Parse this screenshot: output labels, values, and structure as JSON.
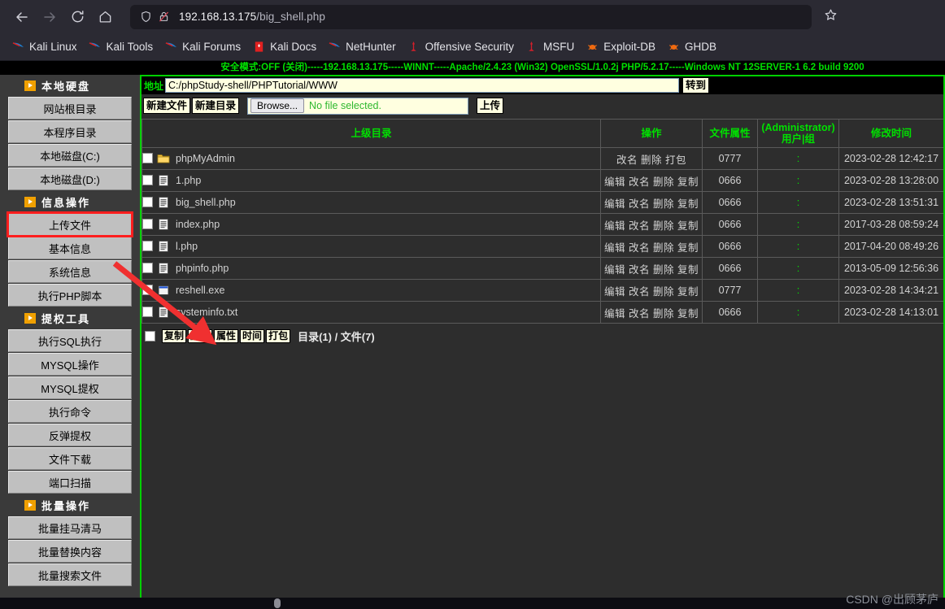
{
  "browser": {
    "back_icon": "back-arrow-icon",
    "forward_icon": "forward-arrow-icon",
    "reload_icon": "reload-icon",
    "home_icon": "home-icon",
    "url_host": "192.168.13.175",
    "url_path": "/big_shell.php",
    "shield_icon": "shield-icon",
    "lock_broken_icon": "lock-crossed-icon",
    "star_icon": "bookmark-star-icon",
    "bookmarks": [
      {
        "label": "Kali Linux",
        "icon": "kali-dragon-icon"
      },
      {
        "label": "Kali Tools",
        "icon": "kali-dragon-icon"
      },
      {
        "label": "Kali Forums",
        "icon": "kali-dragon-icon"
      },
      {
        "label": "Kali Docs",
        "icon": "kali-docs-icon"
      },
      {
        "label": "NetHunter",
        "icon": "kali-dragon-icon"
      },
      {
        "label": "Offensive Security",
        "icon": "offsec-icon"
      },
      {
        "label": "MSFU",
        "icon": "offsec-icon"
      },
      {
        "label": "Exploit-DB",
        "icon": "exploitdb-icon"
      },
      {
        "label": "GHDB",
        "icon": "exploitdb-icon"
      }
    ]
  },
  "status_banner": "安全模式:OFF (关闭)-----192.168.13.175-----WINNT-----Apache/2.4.23 (Win32) OpenSSL/1.0.2j PHP/5.2.17-----Windows NT 12SERVER-1 6.2 build 9200",
  "sidebar": {
    "sections": [
      {
        "title": "本地硬盘",
        "items": [
          {
            "label": "网站根目录",
            "highlight": false
          },
          {
            "label": "本程序目录",
            "highlight": false
          },
          {
            "label": "本地磁盘(C:)",
            "highlight": false
          },
          {
            "label": "本地磁盘(D:)",
            "highlight": false
          }
        ]
      },
      {
        "title": "信息操作",
        "items": [
          {
            "label": "上传文件",
            "highlight": true
          },
          {
            "label": "基本信息",
            "highlight": false
          },
          {
            "label": "系统信息",
            "highlight": false
          },
          {
            "label": "执行PHP脚本",
            "highlight": false
          }
        ]
      },
      {
        "title": "提权工具",
        "items": [
          {
            "label": "执行SQL执行",
            "highlight": false
          },
          {
            "label": "MYSQL操作",
            "highlight": false
          },
          {
            "label": "MYSQL提权",
            "highlight": false
          },
          {
            "label": "执行命令",
            "highlight": false
          },
          {
            "label": "反弹提权",
            "highlight": false
          },
          {
            "label": "文件下载",
            "highlight": false
          },
          {
            "label": "端口扫描",
            "highlight": false
          }
        ]
      },
      {
        "title": "批量操作",
        "items": [
          {
            "label": "批量挂马清马",
            "highlight": false
          },
          {
            "label": "批量替换内容",
            "highlight": false
          },
          {
            "label": "批量搜索文件",
            "highlight": false
          }
        ]
      }
    ]
  },
  "filemanager": {
    "address_label": "地址",
    "address_value": "C:/phpStudy-shell/PHPTutorial/WWW",
    "go_label": "转到",
    "new_file_label": "新建文件",
    "new_dir_label": "新建目录",
    "browse_label": "Browse...",
    "file_status": "No file selected.",
    "upload_label": "上传",
    "columns": {
      "name": "上级目录",
      "ops": "操作",
      "attr": "文件属性",
      "owner": "(Administrator)用户|组",
      "time": "修改时间"
    },
    "rows": [
      {
        "name": "phpMyAdmin",
        "icon": "folder-icon",
        "ops": "改名 删除 打包",
        "attr": "0777",
        "owner": ":",
        "time": "2023-02-28 12:42:17"
      },
      {
        "name": "1.php",
        "icon": "text-file-icon",
        "ops": "编辑 改名 删除 复制",
        "attr": "0666",
        "owner": ":",
        "time": "2023-02-28 13:28:00"
      },
      {
        "name": "big_shell.php",
        "icon": "text-file-icon",
        "ops": "编辑 改名 删除 复制",
        "attr": "0666",
        "owner": ":",
        "time": "2023-02-28 13:51:31"
      },
      {
        "name": "index.php",
        "icon": "text-file-icon",
        "ops": "编辑 改名 删除 复制",
        "attr": "0666",
        "owner": ":",
        "time": "2017-03-28 08:59:24"
      },
      {
        "name": "l.php",
        "icon": "text-file-icon",
        "ops": "编辑 改名 删除 复制",
        "attr": "0666",
        "owner": ":",
        "time": "2017-04-20 08:49:26"
      },
      {
        "name": "phpinfo.php",
        "icon": "text-file-icon",
        "ops": "编辑 改名 删除 复制",
        "attr": "0666",
        "owner": ":",
        "time": "2013-05-09 12:56:36"
      },
      {
        "name": "reshell.exe",
        "icon": "exe-file-icon",
        "ops": "编辑 改名 删除 复制",
        "attr": "0777",
        "owner": ":",
        "time": "2023-02-28 14:34:21"
      },
      {
        "name": "systeminfo.txt",
        "icon": "text-file-icon",
        "ops": "编辑 改名 删除 复制",
        "attr": "0666",
        "owner": ":",
        "time": "2023-02-28 14:13:01"
      }
    ],
    "bottom_actions": [
      "复制",
      "删除",
      "属性",
      "时间",
      "打包"
    ],
    "counts": "目录(1) / 文件(7)"
  },
  "annotation": {
    "arrow_color": "#f03030",
    "target": "reshell.exe"
  },
  "watermark": "CSDN @出顾茅庐"
}
